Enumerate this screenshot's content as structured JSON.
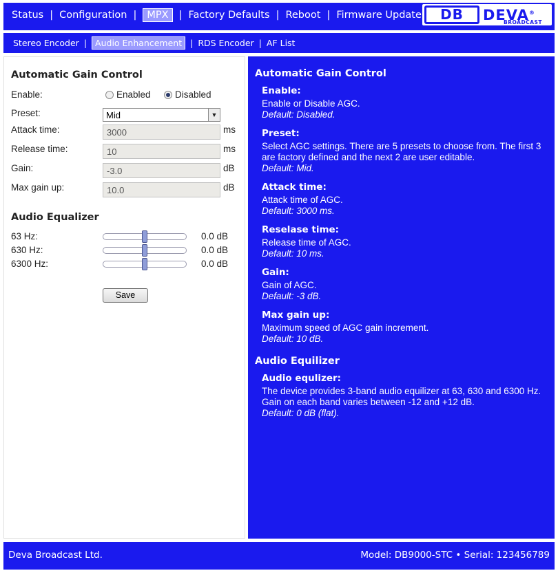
{
  "nav": {
    "items": [
      "Status",
      "Configuration",
      "MPX",
      "Factory Defaults",
      "Reboot",
      "Firmware Update"
    ],
    "active": "MPX"
  },
  "logo": {
    "mark": "DB",
    "brand": "DEVA",
    "registered": "®",
    "sub": "BROADCAST"
  },
  "subnav": {
    "items": [
      "Stereo Encoder",
      "Audio Enhancement",
      "RDS Encoder",
      "AF List"
    ],
    "active": "Audio Enhancement"
  },
  "agc": {
    "title": "Automatic Gain Control",
    "enable_label": "Enable:",
    "enabled_option": "Enabled",
    "disabled_option": "Disabled",
    "selected": "Disabled",
    "preset_label": "Preset:",
    "preset_value": "Mid",
    "attack_label": "Attack time:",
    "attack_value": "3000",
    "attack_unit": "ms",
    "release_label": "Release time:",
    "release_value": "10",
    "release_unit": "ms",
    "gain_label": "Gain:",
    "gain_value": "-3.0",
    "gain_unit": "dB",
    "maxgain_label": "Max gain up:",
    "maxgain_value": "10.0",
    "maxgain_unit": "dB"
  },
  "eq": {
    "title": "Audio Equalizer",
    "bands": [
      {
        "label": "63 Hz:",
        "value": "0.0 dB",
        "level": 0.5
      },
      {
        "label": "630 Hz:",
        "value": "0.0 dB",
        "level": 0.5
      },
      {
        "label": "6300 Hz:",
        "value": "0.0 dB",
        "level": 0.5
      }
    ],
    "save_label": "Save"
  },
  "help": {
    "agc_title": "Automatic Gain Control",
    "agc_items": [
      {
        "title": "Enable:",
        "desc": "Enable or Disable AGC.",
        "default": "Default: Disabled."
      },
      {
        "title": "Preset:",
        "desc": "Select AGC settings. There are 5 presets to choose from. The first 3 are factory defined and the next 2 are user editable.",
        "default": "Default: Mid."
      },
      {
        "title": "Attack time:",
        "desc": "Attack time of AGC.",
        "default": "Default: 3000 ms."
      },
      {
        "title": "Reselase time:",
        "desc": "Release time of AGC.",
        "default": "Default: 10 ms."
      },
      {
        "title": "Gain:",
        "desc": "Gain of AGC.",
        "default": "Default: -3 dB."
      },
      {
        "title": "Max gain up:",
        "desc": "Maximum speed of AGC gain increment.",
        "default": "Default: 10 dB."
      }
    ],
    "eq_title": "Audio Equilizer",
    "eq_items": [
      {
        "title": "Audio equlizer:",
        "desc": "The device provides 3-band audio equilizer at 63, 630 and 6300 Hz. Gain on each band varies between -12 and +12 dB.",
        "default": "Default: 0 dB (flat)."
      }
    ]
  },
  "footer": {
    "company": "Deva Broadcast Ltd.",
    "model_info": "Model: DB9000-STC • Serial: 123456789"
  }
}
